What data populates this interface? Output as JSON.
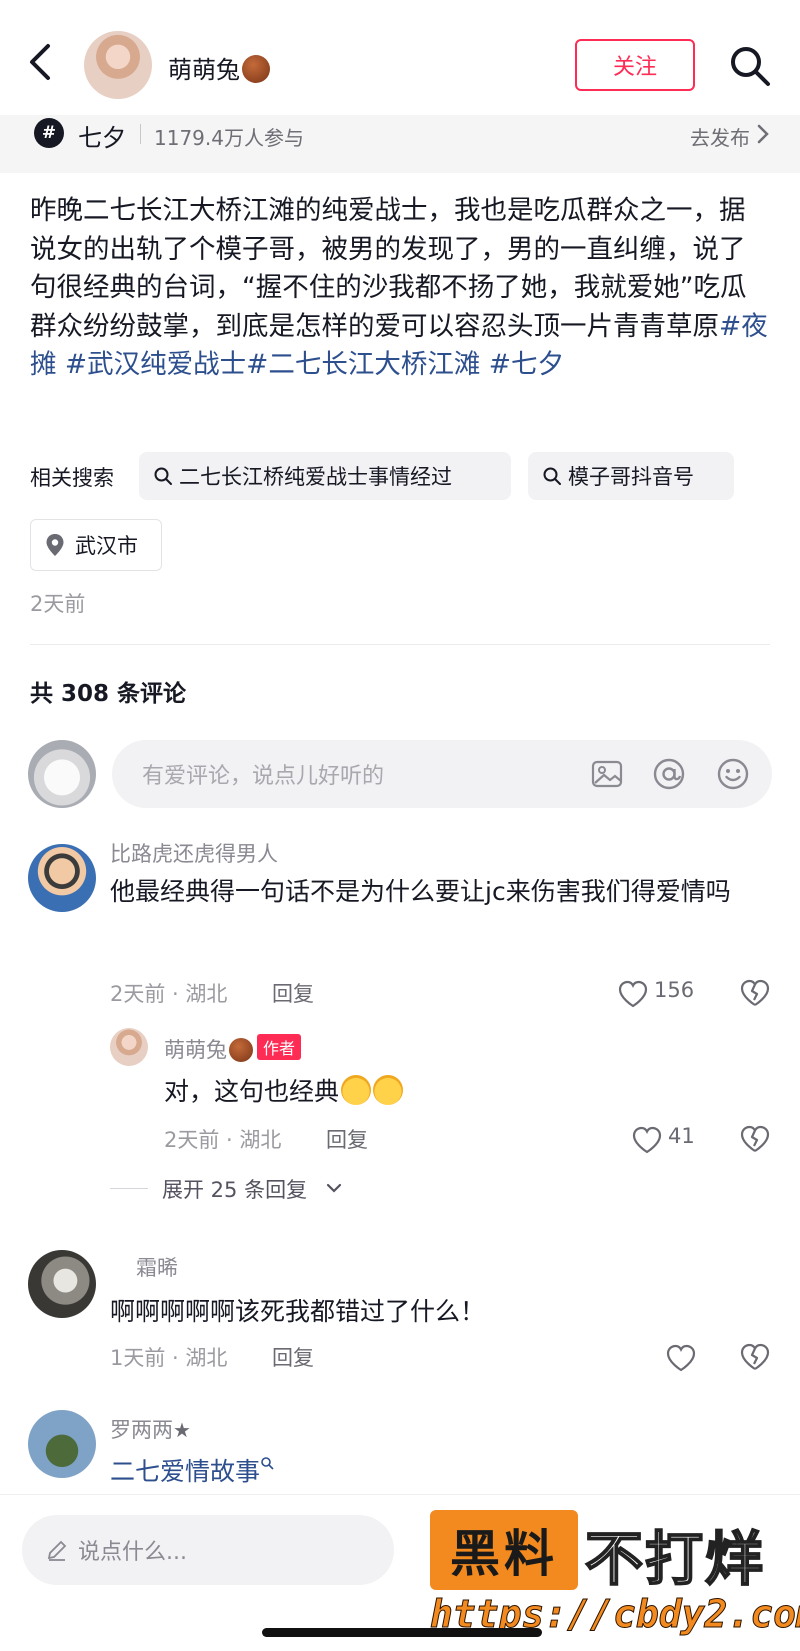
{
  "header": {
    "author_name": "萌萌兔",
    "follow_label": "关注"
  },
  "topic": {
    "name": "七夕",
    "participants": "1179.4万人参与",
    "publish_label": "去发布"
  },
  "caption": {
    "text": "昨晚二七长江大桥江滩的纯爱战士，我也是吃瓜群众之一，据说女的出轨了个模子哥，被男的发现了，男的一直纠缠，说了句很经典的台词，“握不住的沙我都不扬了她，我就爱她”吃瓜群众纷纷鼓掌，到底是怎样的爱可以容忍头顶一片青青草原",
    "tags": [
      "#夜摊",
      " #武汉纯爱战士",
      "#二七长江大桥江滩",
      " #七夕"
    ]
  },
  "related": {
    "label": "相关搜索",
    "items": [
      "二七长江桥纯爱战士事情经过",
      "模子哥抖音号"
    ]
  },
  "location": "武汉市",
  "post_time": "2天前",
  "comment_count": "共 308 条评论",
  "input_placeholder": "有爱评论，说点儿好听的",
  "comments": [
    {
      "name": "比路虎还虎得男人",
      "text": "他最经典得一句话不是为什么要让jc来伤害我们得爱情吗",
      "meta": "2天前 · 湖北",
      "reply_label": "回复",
      "likes": "156"
    },
    {
      "name": "萌萌兔",
      "badge": "作者",
      "text": "对，这句也经典",
      "meta": "2天前 · 湖北",
      "reply_label": "回复",
      "likes": "41"
    },
    {
      "name": "霜晞",
      "text": "啊啊啊啊啊该死我都错过了什么！",
      "meta": "1天前 · 湖北",
      "reply_label": "回复",
      "likes": ""
    },
    {
      "name": "罗两两",
      "star": "★",
      "text": "二七爱情故事"
    }
  ],
  "expand_label": "展开 25 条回复",
  "bottom_placeholder": "说点什么...",
  "watermark": {
    "box": "黑料",
    "text": "不打烊",
    "url": "https://cbdy2.com"
  },
  "colors": {
    "accent": "#fe2c55",
    "link": "#2d4f8e",
    "watermark": "#f28a1f"
  }
}
